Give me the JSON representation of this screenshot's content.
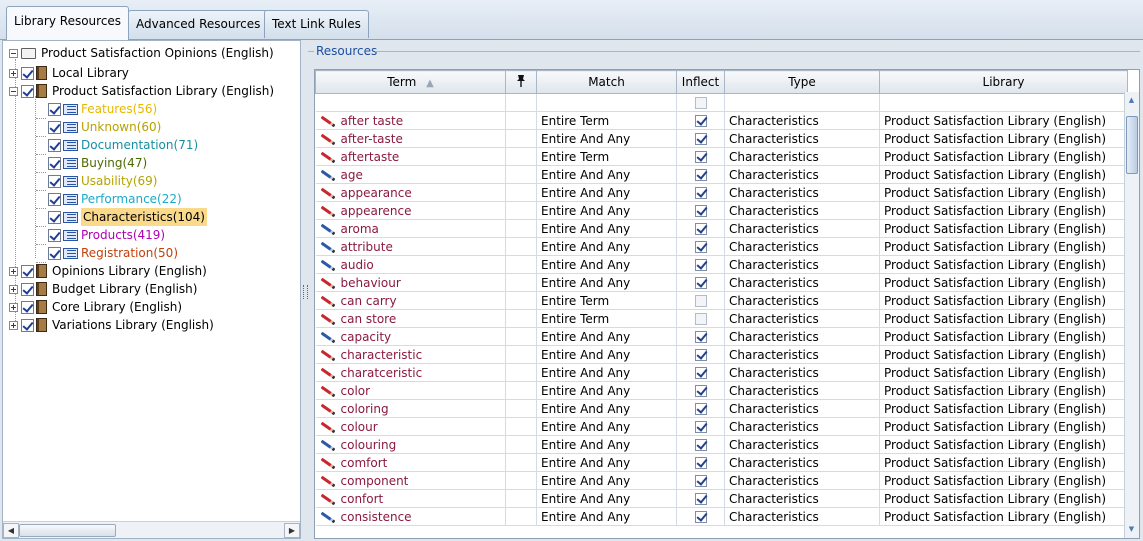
{
  "tabs": [
    "Library Resources",
    "Advanced Resources",
    "Text Link Rules"
  ],
  "tree": {
    "root": "Product Satisfaction Opinions (English)",
    "libraries": [
      {
        "label": "Local Library"
      },
      {
        "label": "Product Satisfaction Library (English)"
      },
      {
        "label": "Opinions Library (English)"
      },
      {
        "label": "Budget Library (English)"
      },
      {
        "label": "Core Library (English)"
      },
      {
        "label": "Variations Library (English)"
      }
    ],
    "categories": [
      {
        "label": "Features(56)",
        "color": "#e6b800"
      },
      {
        "label": "Unknown(60)",
        "color": "#b8a100"
      },
      {
        "label": "Documentation(71)",
        "color": "#168fa0"
      },
      {
        "label": "Buying(47)",
        "color": "#4d6a00"
      },
      {
        "label": "Usability(69)",
        "color": "#b3a300"
      },
      {
        "label": "Performance(22)",
        "color": "#1ea9c9"
      },
      {
        "label": "Characteristics(104)",
        "color": "#000000"
      },
      {
        "label": "Products(419)",
        "color": "#b000b5"
      },
      {
        "label": "Registration(50)",
        "color": "#c2400c"
      }
    ]
  },
  "resources": {
    "legend": "Resources",
    "columns": {
      "term": "Term",
      "match": "Match",
      "inflect": "Inflect",
      "type": "Type",
      "library": "Library"
    },
    "sort_indicator": "▲",
    "rows": [
      {
        "term": "after taste",
        "match": "Entire Term",
        "inflect": true,
        "type": "Characteristics",
        "library": "Product Satisfaction Library (English)",
        "icon": "red"
      },
      {
        "term": "after-taste",
        "match": "Entire And Any",
        "inflect": true,
        "type": "Characteristics",
        "library": "Product Satisfaction Library (English)",
        "icon": "red"
      },
      {
        "term": "aftertaste",
        "match": "Entire Term",
        "inflect": true,
        "type": "Characteristics",
        "library": "Product Satisfaction Library (English)",
        "icon": "red"
      },
      {
        "term": "age",
        "match": "Entire And Any",
        "inflect": true,
        "type": "Characteristics",
        "library": "Product Satisfaction Library (English)",
        "icon": "blue"
      },
      {
        "term": "appearance",
        "match": "Entire And Any",
        "inflect": true,
        "type": "Characteristics",
        "library": "Product Satisfaction Library (English)",
        "icon": "red"
      },
      {
        "term": "appearence",
        "match": "Entire And Any",
        "inflect": true,
        "type": "Characteristics",
        "library": "Product Satisfaction Library (English)",
        "icon": "red"
      },
      {
        "term": "aroma",
        "match": "Entire And Any",
        "inflect": true,
        "type": "Characteristics",
        "library": "Product Satisfaction Library (English)",
        "icon": "blue"
      },
      {
        "term": "attribute",
        "match": "Entire And Any",
        "inflect": true,
        "type": "Characteristics",
        "library": "Product Satisfaction Library (English)",
        "icon": "blue"
      },
      {
        "term": "audio",
        "match": "Entire And Any",
        "inflect": true,
        "type": "Characteristics",
        "library": "Product Satisfaction Library (English)",
        "icon": "blue"
      },
      {
        "term": "behaviour",
        "match": "Entire And Any",
        "inflect": true,
        "type": "Characteristics",
        "library": "Product Satisfaction Library (English)",
        "icon": "red"
      },
      {
        "term": "can carry",
        "match": "Entire Term",
        "inflect": false,
        "type": "Characteristics",
        "library": "Product Satisfaction Library (English)",
        "icon": "red"
      },
      {
        "term": "can store",
        "match": "Entire Term",
        "inflect": false,
        "type": "Characteristics",
        "library": "Product Satisfaction Library (English)",
        "icon": "red"
      },
      {
        "term": "capacity",
        "match": "Entire And Any",
        "inflect": true,
        "type": "Characteristics",
        "library": "Product Satisfaction Library (English)",
        "icon": "blue"
      },
      {
        "term": "characteristic",
        "match": "Entire And Any",
        "inflect": true,
        "type": "Characteristics",
        "library": "Product Satisfaction Library (English)",
        "icon": "red"
      },
      {
        "term": "charatceristic",
        "match": "Entire And Any",
        "inflect": true,
        "type": "Characteristics",
        "library": "Product Satisfaction Library (English)",
        "icon": "red"
      },
      {
        "term": "color",
        "match": "Entire And Any",
        "inflect": true,
        "type": "Characteristics",
        "library": "Product Satisfaction Library (English)",
        "icon": "red"
      },
      {
        "term": "coloring",
        "match": "Entire And Any",
        "inflect": true,
        "type": "Characteristics",
        "library": "Product Satisfaction Library (English)",
        "icon": "red"
      },
      {
        "term": "colour",
        "match": "Entire And Any",
        "inflect": true,
        "type": "Characteristics",
        "library": "Product Satisfaction Library (English)",
        "icon": "red"
      },
      {
        "term": "colouring",
        "match": "Entire And Any",
        "inflect": true,
        "type": "Characteristics",
        "library": "Product Satisfaction Library (English)",
        "icon": "blue"
      },
      {
        "term": "comfort",
        "match": "Entire And Any",
        "inflect": true,
        "type": "Characteristics",
        "library": "Product Satisfaction Library (English)",
        "icon": "red"
      },
      {
        "term": "component",
        "match": "Entire And Any",
        "inflect": true,
        "type": "Characteristics",
        "library": "Product Satisfaction Library (English)",
        "icon": "red"
      },
      {
        "term": "confort",
        "match": "Entire And Any",
        "inflect": true,
        "type": "Characteristics",
        "library": "Product Satisfaction Library (English)",
        "icon": "red"
      },
      {
        "term": "consistence",
        "match": "Entire And Any",
        "inflect": true,
        "type": "Characteristics",
        "library": "Product Satisfaction Library (English)",
        "icon": "blue"
      }
    ]
  }
}
